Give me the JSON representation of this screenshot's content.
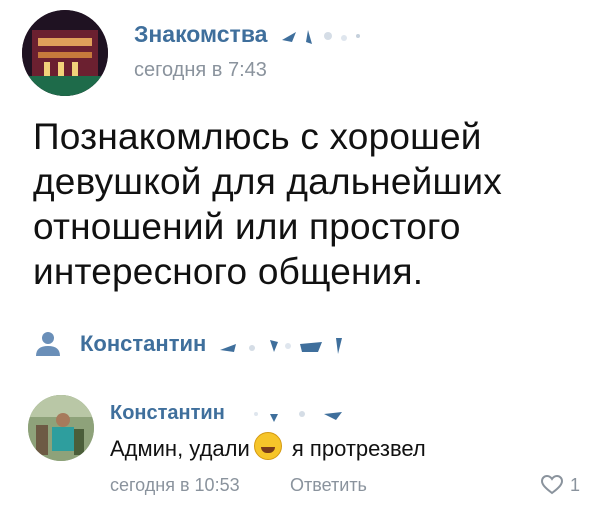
{
  "post": {
    "author": "Знакомства",
    "time": "сегодня в 7:43",
    "text_lines": [
      "Познакомлюсь с хорошей",
      "девушкой для дальнейших",
      "отношений или простого",
      "интересного общения."
    ]
  },
  "signed_by": {
    "name": "Константин"
  },
  "comment": {
    "author": "Константин",
    "text_before": "Админ, удали",
    "text_after": "я протрезвел",
    "time": "сегодня в 10:53",
    "reply_label": "Ответить",
    "likes": "1"
  },
  "colors": {
    "link": "#3f6f9c",
    "meta": "#8a939d",
    "user_icon": "#6a8fb8"
  },
  "icons": [
    "person-icon",
    "heart-outline-icon",
    "rofl-emoji-icon"
  ]
}
